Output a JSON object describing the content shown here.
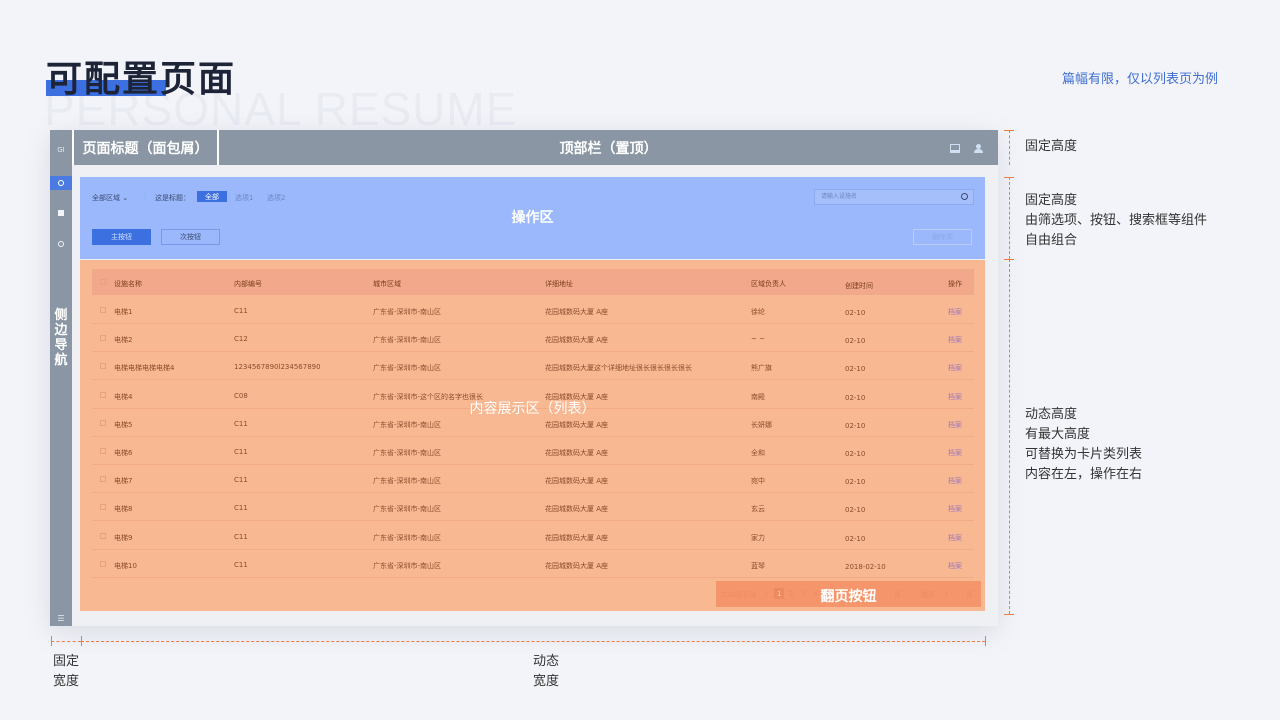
{
  "header": {
    "title": "可配置页面",
    "bg_text": "PERSONAL  RESUME",
    "note": "篇幅有限，仅以列表页为例"
  },
  "sidenav": {
    "logo": "GI",
    "label": "侧边导航",
    "bottom_icon": "☰"
  },
  "breadcrumb": "页面标题（面包屑）",
  "topbar": "顶部栏（置顶）",
  "ops": {
    "title": "操作区",
    "filter_area": "全部区域",
    "filter_label": "这是标题：",
    "options": [
      "全部",
      "选项1",
      "选项2"
    ],
    "search_placeholder": "请输入设施名",
    "primary_button": "主按钮",
    "secondary_button": "次按钮",
    "delete_button": "删除类"
  },
  "list": {
    "title": "内容展示区（列表）",
    "columns": [
      "设施名称",
      "内部编号",
      "城市区域",
      "详细地址",
      "区域负责人",
      "创建时间",
      "操作"
    ],
    "rows": [
      [
        "电梯1",
        "C11",
        "广东省-深圳市-南山区",
        "花园城数码大厦 A座",
        "徐纶",
        "02-10",
        "档案"
      ],
      [
        "电梯2",
        "C12",
        "广东省-深圳市-南山区",
        "花园城数码大厦 A座",
        "~ ~",
        "02-10",
        "档案"
      ],
      [
        "电梯电梯电梯电梯4",
        "1234567890l234567890",
        "广东省-深圳市-南山区",
        "花园城数码大厦这个详细地址很长很长很长很长",
        "熊广旗",
        "02-10",
        "档案"
      ],
      [
        "电梯4",
        "C08",
        "广东省-深圳市-这个区的名字也很长",
        "花园城数码大厦 A座",
        "南殿",
        "02-10",
        "档案"
      ],
      [
        "电梯5",
        "C11",
        "广东省-深圳市-南山区",
        "花园城数码大厦 A座",
        "长妍娜",
        "02-10",
        "档案"
      ],
      [
        "电梯6",
        "C11",
        "广东省-深圳市-南山区",
        "花园城数码大厦 A座",
        "全和",
        "02-10",
        "档案"
      ],
      [
        "电梯7",
        "C11",
        "广东省-深圳市-南山区",
        "花园城数码大厦 A座",
        "宛中",
        "02-10",
        "档案"
      ],
      [
        "电梯8",
        "C11",
        "广东省-深圳市-南山区",
        "花园城数码大厦 A座",
        "玄云",
        "02-10",
        "档案"
      ],
      [
        "电梯9",
        "C11",
        "广东省-深圳市-南山区",
        "花园城数码大厦 A座",
        "家力",
        "02-10",
        "档案"
      ],
      [
        "电梯10",
        "C11",
        "广东省-深圳市-南山区",
        "花园城数码大厦 A座",
        "蓝琴",
        "2018-02-10",
        "档案"
      ]
    ]
  },
  "pager": {
    "label": "翻页按钮",
    "total": "共20条记录",
    "pages": [
      "1",
      "2",
      "3",
      "4",
      "5"
    ],
    "page_unit": "页",
    "jump": "跳至",
    "jump_value": "1"
  },
  "annotations": {
    "fixed_height_1": "固定高度",
    "fixed_height_2": [
      "固定高度",
      "由筛选项、按钮、搜索框等组件",
      "自由组合"
    ],
    "dynamic_height": [
      "动态高度",
      "有最大高度",
      "可替换为卡片类列表",
      "内容在左，操作在右"
    ],
    "fixed_width": [
      "固定",
      "宽度"
    ],
    "dynamic_width": [
      "动态",
      "宽度"
    ]
  },
  "colors": {
    "accent": "#3c6fe0",
    "nav_gray": "#8a96a4",
    "ops_blue": "#9ab8fb",
    "list_orange": "#f8b892",
    "dimension_line": "#f07b3f"
  }
}
